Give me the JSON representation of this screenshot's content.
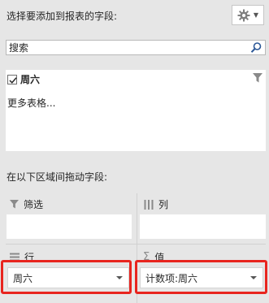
{
  "header": {
    "title": "选择要添加到报表的字段:",
    "gear_icon": "gear-icon"
  },
  "search": {
    "placeholder": "搜索",
    "value": ""
  },
  "field_list": {
    "items": [
      {
        "label": "周六",
        "checked": true
      }
    ],
    "more_tables": "更多表格..."
  },
  "drag_instruction": "在以下区域间拖动字段:",
  "areas": {
    "filters": {
      "label": "筛选",
      "items": []
    },
    "columns": {
      "label": "列",
      "items": []
    },
    "rows": {
      "label": "行",
      "items": [
        "周六"
      ]
    },
    "values": {
      "label": "值",
      "items": [
        "计数项:周六"
      ]
    }
  },
  "colors": {
    "panel_bg": "#e6e6e6",
    "highlight": "#e8251f"
  }
}
